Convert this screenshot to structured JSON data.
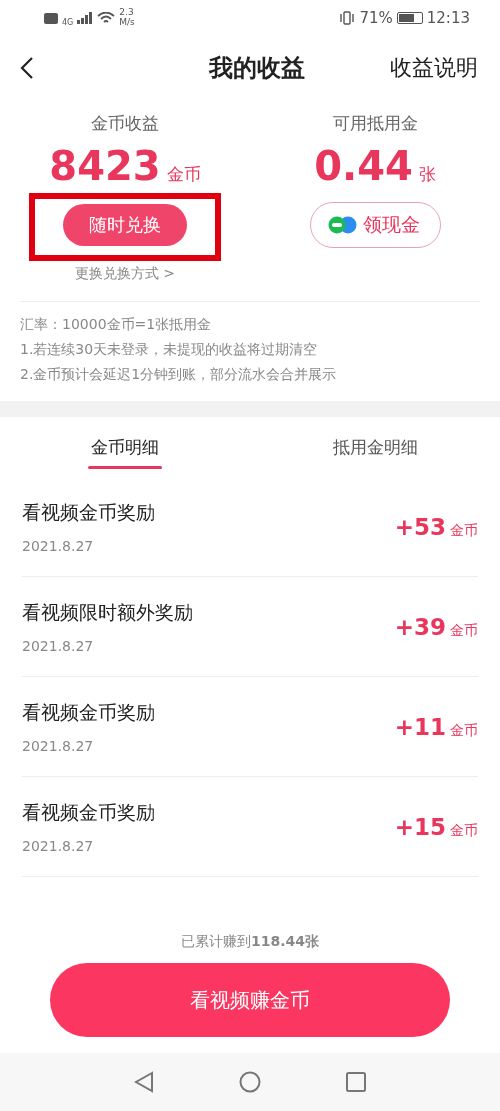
{
  "status_bar": {
    "network": "4G",
    "speed": "2.3\nM/s",
    "battery_text": "71%",
    "time": "12:13"
  },
  "header": {
    "title": "我的收益",
    "action": "收益说明"
  },
  "stats": [
    {
      "label": "金币收益",
      "value": "8423",
      "unit": "金币",
      "button": "随时兑换",
      "kind": "filled",
      "highlighted": true,
      "note": "更换兑换方式 >"
    },
    {
      "label": "可用抵用金",
      "value": "0.44",
      "unit": "张",
      "button": "领现金",
      "kind": "outlined",
      "highlighted": false
    }
  ],
  "rules": [
    "汇率：10000金币=1张抵用金",
    "1.若连续30天未登录，未提现的收益将过期清空",
    "2.金币预计会延迟1分钟到账，部分流水会合并展示"
  ],
  "tabs": [
    {
      "label": "金币明细",
      "selected": true
    },
    {
      "label": "抵用金明细",
      "selected": false
    }
  ],
  "records": [
    {
      "title": "看视频金币奖励",
      "date": "2021.8.27",
      "amount": "+53",
      "unit": "金币"
    },
    {
      "title": "看视频限时额外奖励",
      "date": "2021.8.27",
      "amount": "+39",
      "unit": "金币"
    },
    {
      "title": "看视频金币奖励",
      "date": "2021.8.27",
      "amount": "+11",
      "unit": "金币"
    },
    {
      "title": "看视频金币奖励",
      "date": "2021.8.27",
      "amount": "+15",
      "unit": "金币"
    }
  ],
  "footer": {
    "total": "已累计赚到**118.44张**",
    "button": "看视频赚金币"
  }
}
